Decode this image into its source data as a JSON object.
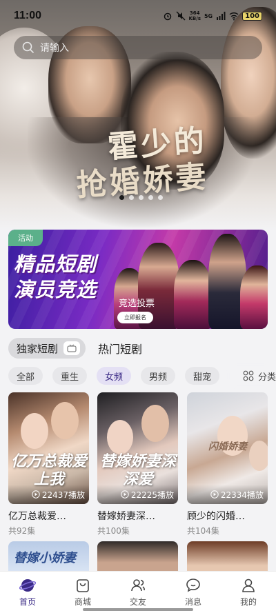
{
  "status": {
    "time": "11:00",
    "net_speed": "364",
    "net_unit": "KB/s",
    "signal": "5G",
    "battery": "100"
  },
  "search": {
    "placeholder": "请输入"
  },
  "hero": {
    "title_line1": "霍少的",
    "title_line2": "抢婚娇妻",
    "dots": 5,
    "active_dot": 0
  },
  "banner": {
    "tag": "活动",
    "headline_1": "精品短剧",
    "headline_2": "演员竞选",
    "subtitle": "竞选投票",
    "cta": "立即报名"
  },
  "sections": {
    "exclusive": "独家短剧",
    "hot": "热门短剧"
  },
  "chips": [
    {
      "label": "全部",
      "active": false
    },
    {
      "label": "重生",
      "active": false
    },
    {
      "label": "女频",
      "active": true
    },
    {
      "label": "男频",
      "active": false
    },
    {
      "label": "甜宠",
      "active": false
    }
  ],
  "category_button": "分类",
  "dramas": [
    {
      "poster_text": "亿万总裁爱上我",
      "plays": "22437播放",
      "title": "亿万总裁爱…",
      "episodes": "共92集"
    },
    {
      "poster_text": "替嫁娇妻深深爱",
      "plays": "22225播放",
      "title": "替嫁娇妻深…",
      "episodes": "共100集"
    },
    {
      "poster_text": "闪婚娇妻",
      "plays": "22334播放",
      "title": "顾少的闪婚…",
      "episodes": "共104集"
    }
  ],
  "row2": {
    "first_poster_text": "替嫁小娇妻"
  },
  "tabbar": [
    {
      "label": "首页",
      "icon": "home-planet-icon",
      "active": true
    },
    {
      "label": "商城",
      "icon": "shopping-bag-icon",
      "active": false
    },
    {
      "label": "交友",
      "icon": "friends-icon",
      "active": false
    },
    {
      "label": "消息",
      "icon": "message-icon",
      "active": false
    },
    {
      "label": "我的",
      "icon": "profile-icon",
      "active": false
    }
  ],
  "colors": {
    "accent": "#3a2a86",
    "active_chip_bg": "#e4e0f4",
    "tag_green": "#5bb08a"
  }
}
